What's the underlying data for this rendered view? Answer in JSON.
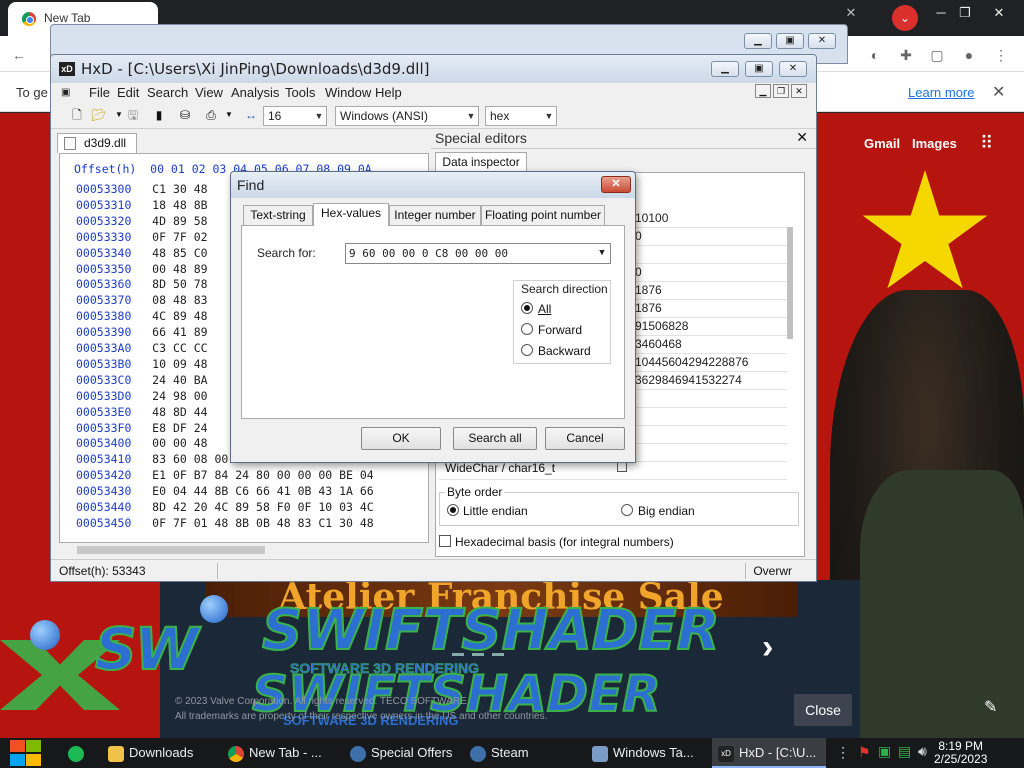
{
  "browser": {
    "tab_title": "New Tab",
    "info_bar_text": "To ge",
    "learn_more": "Learn more",
    "links": [
      "Gmail",
      "Images"
    ]
  },
  "steam": {
    "banner": "Atelier Franchise Sale",
    "brand": "SWIFTSHADER",
    "brand_sub": "SOFTWARE 3D RENDERING",
    "footer_line1": "© 2023 Valve Corporation. All rights reserved. TECO SOFTWARE",
    "footer_line2": "All trademarks are property of their respective owners in the US and other countries.",
    "close_label": "Close"
  },
  "hxd": {
    "title": "HxD - [C:\\Users\\Xi JinPing\\Downloads\\d3d9.dll]",
    "menu": [
      "File",
      "Edit",
      "Search",
      "View",
      "Analysis",
      "Tools",
      "Window",
      "Help"
    ],
    "toolbar": {
      "bytes_per_row": "16",
      "charset": "Windows (ANSI)",
      "display_mode": "hex"
    },
    "doc_tab": "d3d9.dll",
    "offset_header": "Offset(h)  00 01 02 03 04 05 06 07 08 09 0A",
    "rows": [
      {
        "offset": "00053300",
        "bytes": "C1 30 48"
      },
      {
        "offset": "00053310",
        "bytes": "18 48 8B"
      },
      {
        "offset": "00053320",
        "bytes": "4D 89 58"
      },
      {
        "offset": "00053330",
        "bytes": "0F 7F 02"
      },
      {
        "offset": "00053340",
        "bytes": "48 85 C0"
      },
      {
        "offset": "00053350",
        "bytes": "00 48 89"
      },
      {
        "offset": "00053360",
        "bytes": "8D 50 78"
      },
      {
        "offset": "00053370",
        "bytes": "08 48 83"
      },
      {
        "offset": "00053380",
        "bytes": "4C 89 48"
      },
      {
        "offset": "00053390",
        "bytes": "66 41 89"
      },
      {
        "offset": "000533A0",
        "bytes": "C3 CC CC"
      },
      {
        "offset": "000533B0",
        "bytes": "10 09 48"
      },
      {
        "offset": "000533C0",
        "bytes": "24 40 BA"
      },
      {
        "offset": "000533D0",
        "bytes": "24 98 00"
      },
      {
        "offset": "000533E0",
        "bytes": "48 8D 44"
      },
      {
        "offset": "000533F0",
        "bytes": "E8 DF 24"
      },
      {
        "offset": "00053400",
        "bytes": "00 00 48"
      },
      {
        "offset": "00053410",
        "bytes": "83 60 08 00 48 83 60 10 00 48 83"
      },
      {
        "offset": "00053420",
        "bytes": "E1 0F B7 84 24 80 00 00 00 BE 04"
      },
      {
        "offset": "00053430",
        "bytes": "E0 04 44 8B C6 66 41 0B 43 1A 66"
      },
      {
        "offset": "00053440",
        "bytes": "8D 42 20 4C 89 58 F0 0F 10 03 4C"
      },
      {
        "offset": "00053450",
        "bytes": "0F 7F 01 48 8B 0B 48 83 C1 30 48"
      }
    ],
    "status_offset": "Offset(h): 53343",
    "status_mode": "Overwr",
    "special_editors": "Special editors",
    "data_inspector_tab": "Data inspector",
    "inspector_values": [
      "10100",
      "0",
      "0",
      "1876",
      "1876",
      "91506828",
      "3460468",
      "10445604294228876",
      "3629846941532274"
    ],
    "widechar_label": "WideChar / char16_t",
    "byte_order_label": "Byte order",
    "little_endian": "Little endian",
    "big_endian": "Big endian",
    "hex_basis": "Hexadecimal basis (for integral numbers)"
  },
  "find": {
    "title": "Find",
    "tabs": [
      "Text-string",
      "Hex-values",
      "Integer number",
      "Floating point number"
    ],
    "active_tab": "Hex-values",
    "search_for_label": "Search for:",
    "search_value": "9 60 00 00 0 C8 00 00 00",
    "direction_title": "Search direction",
    "directions": [
      "All",
      "Forward",
      "Backward"
    ],
    "selected_direction": "All",
    "ok": "OK",
    "search_all": "Search all",
    "cancel": "Cancel"
  },
  "taskbar": {
    "apps": [
      "Downloads",
      "New Tab - ...",
      "Special Offers",
      "Steam",
      "Windows Ta...",
      "HxD - [C:\\U..."
    ],
    "time": "8:19 PM",
    "date": "2/25/2023"
  },
  "colors": {
    "flag_red": "#b5140f",
    "flag_star": "#f5d800",
    "offset_blue": "#1c3cc8",
    "steam_dark": "#1b2838"
  }
}
